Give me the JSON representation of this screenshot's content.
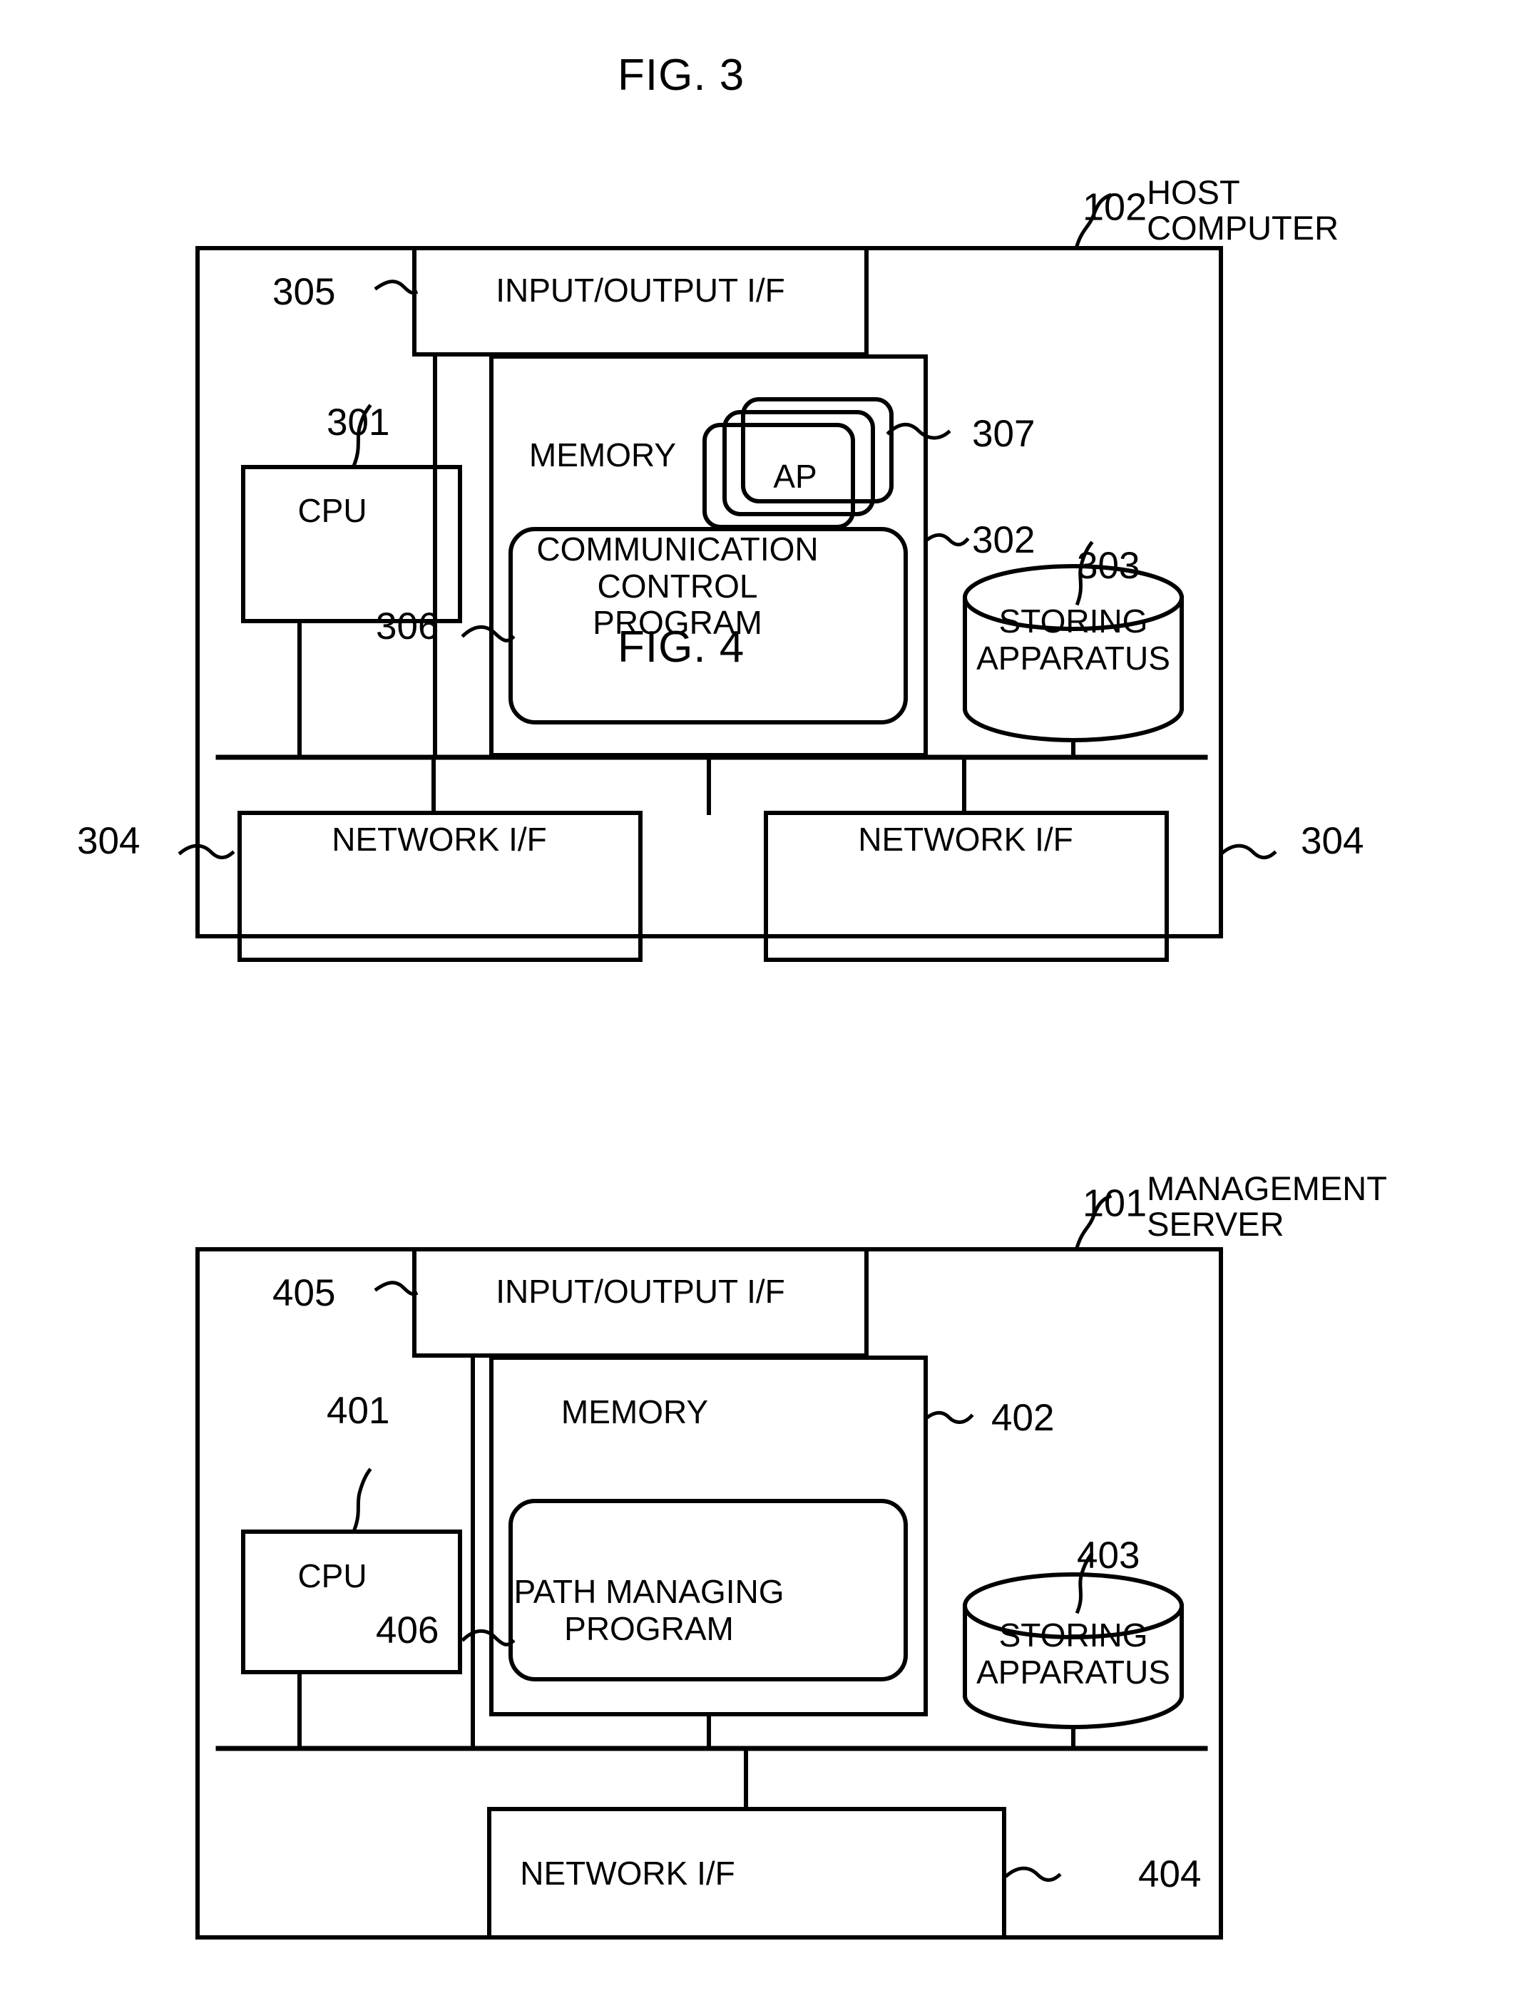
{
  "figures": [
    {
      "id": "fig3",
      "title": "FIG. 3",
      "device_ref": "102",
      "device_name": "HOST\nCOMPUTER",
      "io_if": {
        "label": "INPUT/OUTPUT I/F",
        "ref": "305"
      },
      "cpu": {
        "label": "CPU",
        "ref": "301"
      },
      "memory": {
        "label": "MEMORY",
        "ref": "302"
      },
      "app": {
        "label": "AP",
        "ref": "307",
        "stack_count": 3
      },
      "program": {
        "label": "COMMUNICATION\nCONTROL\nPROGRAM",
        "ref": "306"
      },
      "storage": {
        "label": "STORING\nAPPARATUS",
        "ref": "303"
      },
      "network_ifs": [
        {
          "label": "NETWORK I/F",
          "ref": "304"
        },
        {
          "label": "NETWORK I/F",
          "ref": "304"
        }
      ]
    },
    {
      "id": "fig4",
      "title": "FIG. 4",
      "device_ref": "101",
      "device_name": "MANAGEMENT\nSERVER",
      "io_if": {
        "label": "INPUT/OUTPUT I/F",
        "ref": "405"
      },
      "cpu": {
        "label": "CPU",
        "ref": "401"
      },
      "memory": {
        "label": "MEMORY",
        "ref": "402"
      },
      "program": {
        "label": "PATH MANAGING\nPROGRAM",
        "ref": "406"
      },
      "storage": {
        "label": "STORING\nAPPARATUS",
        "ref": "403"
      },
      "network_ifs": [
        {
          "label": "NETWORK I/F",
          "ref": "404"
        }
      ]
    }
  ],
  "style": {
    "ink": "#000000",
    "paper": "#ffffff"
  }
}
